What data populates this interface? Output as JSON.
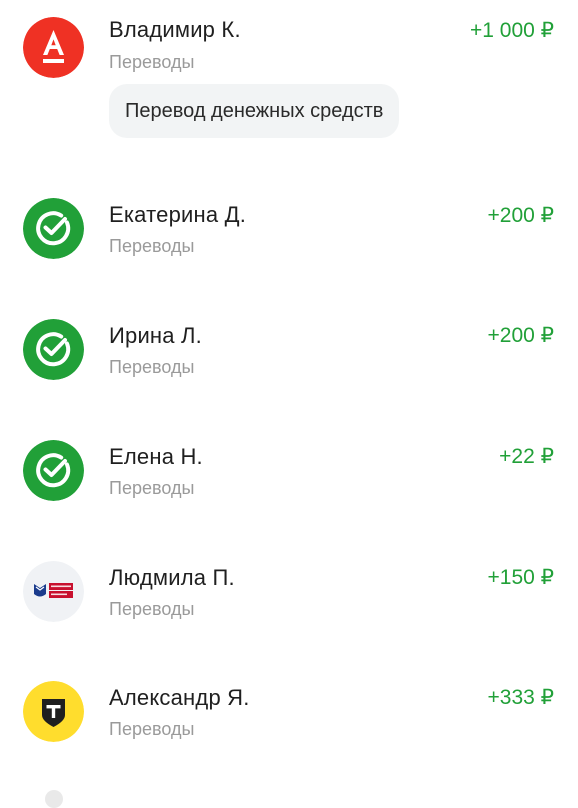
{
  "currency_sign": "₽",
  "transactions": [
    {
      "name": "Владимир К.",
      "category": "Переводы",
      "amount": "+1 000 ₽",
      "note": "Перевод денежных средств",
      "bank_icon": "alfa-bank-icon",
      "bank_color": "#EF3124"
    },
    {
      "name": "Екатерина Д.",
      "category": "Переводы",
      "amount": "+200 ₽",
      "bank_icon": "sber-bank-icon",
      "bank_color": "#21A038"
    },
    {
      "name": "Ирина Л.",
      "category": "Переводы",
      "amount": "+200 ₽",
      "bank_icon": "sber-bank-icon",
      "bank_color": "#21A038"
    },
    {
      "name": "Елена Н.",
      "category": "Переводы",
      "amount": "+22 ₽",
      "bank_icon": "sber-bank-icon",
      "bank_color": "#21A038"
    },
    {
      "name": "Людмила П.",
      "category": "Переводы",
      "amount": "+150 ₽",
      "bank_icon": "pochta-bank-icon",
      "bank_color": "#1A3B8C"
    },
    {
      "name": "Александр Я.",
      "category": "Переводы",
      "amount": "+333 ₽",
      "bank_icon": "t-bank-icon",
      "bank_color": "#FFDD2D"
    }
  ],
  "colors": {
    "amount_positive": "#21A038",
    "secondary_text": "#9A9A9A",
    "bubble_bg": "#F2F4F5"
  }
}
